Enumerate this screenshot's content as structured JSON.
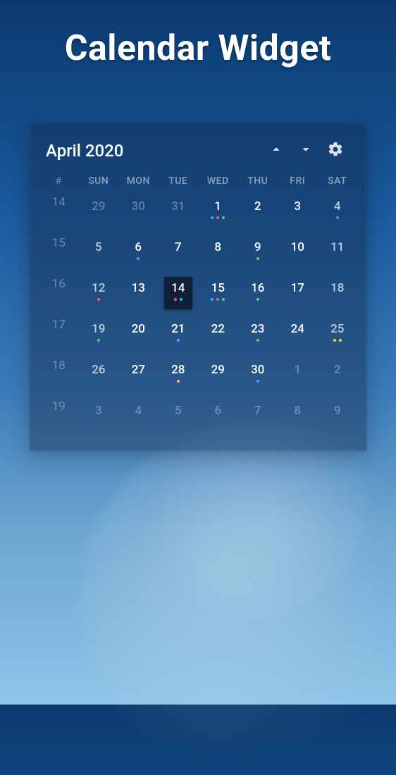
{
  "title": "Calendar Widget",
  "month_label": "April 2020",
  "weekday_headers": [
    "#",
    "SUN",
    "MON",
    "TUE",
    "WED",
    "THU",
    "FRI",
    "SAT"
  ],
  "weeks": [
    {
      "num": 14,
      "days": [
        {
          "n": 29,
          "m": "other",
          "dots": []
        },
        {
          "n": 30,
          "m": "other",
          "dots": []
        },
        {
          "n": 31,
          "m": "other",
          "dots": []
        },
        {
          "n": 1,
          "m": "curr",
          "dots": [
            "blue",
            "red",
            "green"
          ]
        },
        {
          "n": 2,
          "m": "curr",
          "dots": []
        },
        {
          "n": 3,
          "m": "curr",
          "dots": []
        },
        {
          "n": 4,
          "m": "curr",
          "wkend": true,
          "dots": [
            "blue"
          ]
        }
      ]
    },
    {
      "num": 15,
      "days": [
        {
          "n": 5,
          "m": "curr",
          "wkend": true,
          "dots": []
        },
        {
          "n": 6,
          "m": "curr",
          "dots": [
            "blue"
          ]
        },
        {
          "n": 7,
          "m": "curr",
          "dots": []
        },
        {
          "n": 8,
          "m": "curr",
          "dots": []
        },
        {
          "n": 9,
          "m": "curr",
          "dots": [
            "green"
          ]
        },
        {
          "n": 10,
          "m": "curr",
          "dots": []
        },
        {
          "n": 11,
          "m": "curr",
          "wkend": true,
          "dots": []
        }
      ]
    },
    {
      "num": 16,
      "days": [
        {
          "n": 12,
          "m": "curr",
          "wkend": true,
          "dots": [
            "red"
          ]
        },
        {
          "n": 13,
          "m": "curr",
          "dots": []
        },
        {
          "n": 14,
          "m": "curr",
          "sel": true,
          "dots": [
            "red",
            "blue"
          ]
        },
        {
          "n": 15,
          "m": "curr",
          "dots": [
            "blue",
            "red",
            "green"
          ]
        },
        {
          "n": 16,
          "m": "curr",
          "dots": [
            "green"
          ]
        },
        {
          "n": 17,
          "m": "curr",
          "dots": []
        },
        {
          "n": 18,
          "m": "curr",
          "wkend": true,
          "dots": []
        }
      ]
    },
    {
      "num": 17,
      "days": [
        {
          "n": 19,
          "m": "curr",
          "wkend": true,
          "dots": [
            "green"
          ]
        },
        {
          "n": 20,
          "m": "curr",
          "dots": []
        },
        {
          "n": 21,
          "m": "curr",
          "dots": [
            "purple"
          ]
        },
        {
          "n": 22,
          "m": "curr",
          "dots": []
        },
        {
          "n": 23,
          "m": "curr",
          "dots": [
            "green"
          ]
        },
        {
          "n": 24,
          "m": "curr",
          "dots": []
        },
        {
          "n": 25,
          "m": "curr",
          "wkend": true,
          "dots": [
            "yellow",
            "yellow"
          ]
        }
      ]
    },
    {
      "num": 18,
      "days": [
        {
          "n": 26,
          "m": "curr",
          "wkend": true,
          "dots": []
        },
        {
          "n": 27,
          "m": "curr",
          "dots": []
        },
        {
          "n": 28,
          "m": "curr",
          "dots": [
            "yellow"
          ]
        },
        {
          "n": 29,
          "m": "curr",
          "dots": []
        },
        {
          "n": 30,
          "m": "curr",
          "dots": [
            "blue"
          ]
        },
        {
          "n": 1,
          "m": "other",
          "dots": []
        },
        {
          "n": 2,
          "m": "other",
          "dots": []
        }
      ]
    },
    {
      "num": 19,
      "days": [
        {
          "n": 3,
          "m": "other",
          "dots": []
        },
        {
          "n": 4,
          "m": "other",
          "dots": []
        },
        {
          "n": 5,
          "m": "other",
          "dots": []
        },
        {
          "n": 6,
          "m": "other",
          "dots": []
        },
        {
          "n": 7,
          "m": "other",
          "dots": []
        },
        {
          "n": 8,
          "m": "other",
          "dots": []
        },
        {
          "n": 9,
          "m": "other",
          "dots": []
        }
      ]
    }
  ],
  "colors": {
    "blue": "#3aa6ff",
    "red": "#ff5a5a",
    "green": "#4cd964",
    "yellow": "#ffcc33",
    "purple": "#a67bff"
  }
}
